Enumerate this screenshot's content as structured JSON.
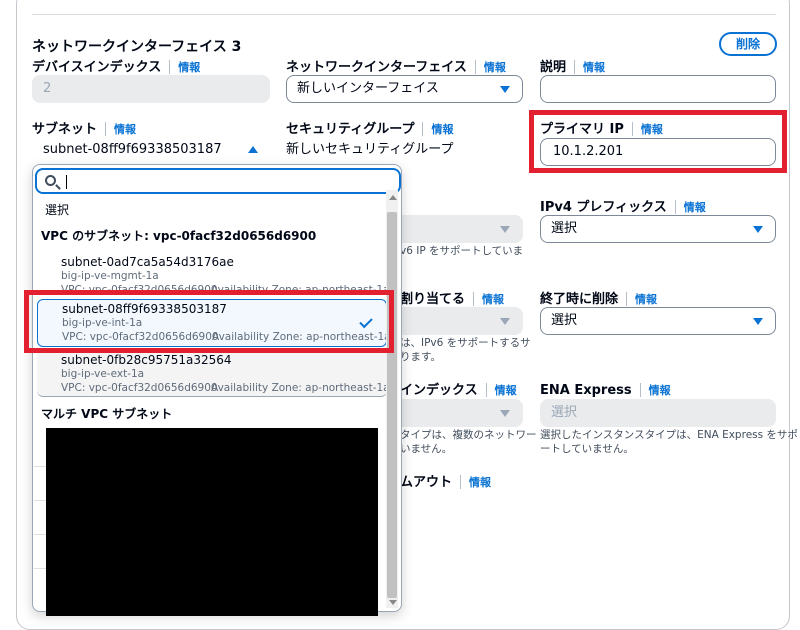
{
  "section": {
    "title": "ネットワークインターフェイス 3",
    "delete_label": "削除"
  },
  "info": "情報",
  "device_index": {
    "label": "デバイスインデックス",
    "value": "2"
  },
  "network_interface": {
    "label": "ネットワークインターフェイス",
    "value": "新しいインターフェイス"
  },
  "description": {
    "label": "説明",
    "value": ""
  },
  "subnet": {
    "label": "サブネット",
    "value": "subnet-08ff9f69338503187"
  },
  "security_group": {
    "label": "セキュリティグループ",
    "value": "新しいセキュリティグループ"
  },
  "primary_ip": {
    "label": "プライマリ IP",
    "value": "10.1.2.201"
  },
  "ipv4_prefix": {
    "label": "IPv4 プレフィックス",
    "value": "選択"
  },
  "delete_on_termination": {
    "label": "終了時に削除",
    "value": "選択"
  },
  "ena_express": {
    "label": "ENA Express",
    "value": "選択",
    "hint_line1": "選択したインスタンスタイプは、ENA Express をサポ",
    "hint_line2": "ートしていません。"
  },
  "partial": {
    "ipv6_hint": "v6 IP をサポートしていま",
    "assign_label": "割り当てる",
    "assign_hint1": "は、IPv6 をサポートするサ",
    "assign_hint2": "ります。",
    "index_label": "インデックス",
    "index_hint1": "タイプは、複数のネットワー",
    "index_hint2": "いません。",
    "timeout_label": "ムアウト"
  },
  "dropdown": {
    "search_placeholder": "",
    "select_option": "選択",
    "group1_title": "VPC のサブネット: vpc-0facf32d0656d6900",
    "options": [
      {
        "name": "subnet-0ad7ca5a54d3176ae",
        "tag": "big-ip-ve-mgmt-1a",
        "vpc": "VPC: vpc-0facf32d0656d6900",
        "az": "Availability Zone: ap-northeast-1a"
      },
      {
        "name": "subnet-08ff9f69338503187",
        "tag": "big-ip-ve-int-1a",
        "vpc": "VPC: vpc-0facf32d0656d6900",
        "az": "Availability Zone: ap-northeast-1a"
      },
      {
        "name": "subnet-0fb28c95751a32564",
        "tag": "big-ip-ve-ext-1a",
        "vpc": "VPC: vpc-0facf32d0656d6900",
        "az": "Availability Zone: ap-northeast-1a"
      }
    ],
    "group2_title": "マルチ VPC サブネット"
  },
  "colors": {
    "accent": "#0972d3",
    "highlight": "#e3202f",
    "text": "#000716"
  }
}
